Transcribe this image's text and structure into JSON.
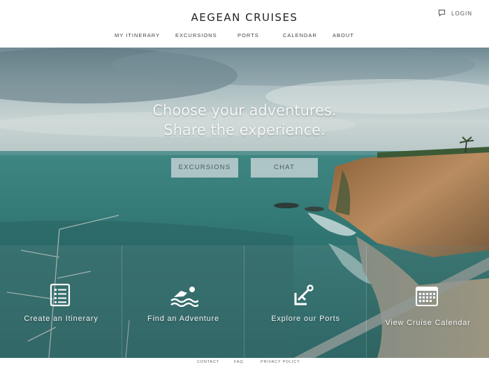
{
  "header": {
    "brand": "AEGEAN CRUISES",
    "login_label": "LOGIN",
    "nav": [
      {
        "label": "MY ITINERARY"
      },
      {
        "label": "EXCURSIONS"
      },
      {
        "label": "PORTS"
      },
      {
        "label": "CALENDAR"
      },
      {
        "label": "ABOUT"
      }
    ]
  },
  "hero": {
    "headline_line1": "Choose your adventures.",
    "headline_line2": "Share the experience.",
    "buttons": [
      {
        "label": "EXCURSIONS"
      },
      {
        "label": "CHAT"
      }
    ]
  },
  "features": [
    {
      "label": "Create an Itinerary",
      "icon": "itinerary-list-icon"
    },
    {
      "label": "Find an Adventure",
      "icon": "swimmer-icon"
    },
    {
      "label": "Explore our Ports",
      "icon": "anchor-icon"
    },
    {
      "label": "View Cruise Calendar",
      "icon": "calendar-icon"
    }
  ],
  "footer": {
    "links": [
      {
        "label": "CONTACT"
      },
      {
        "label": "FAQ"
      },
      {
        "label": "PRIVACY POLICY"
      }
    ]
  },
  "colors": {
    "sea": "#2f7d7a",
    "sky": "#9fb3b9",
    "cliff": "#a77a4f",
    "text_light": "#f2f4f4"
  }
}
